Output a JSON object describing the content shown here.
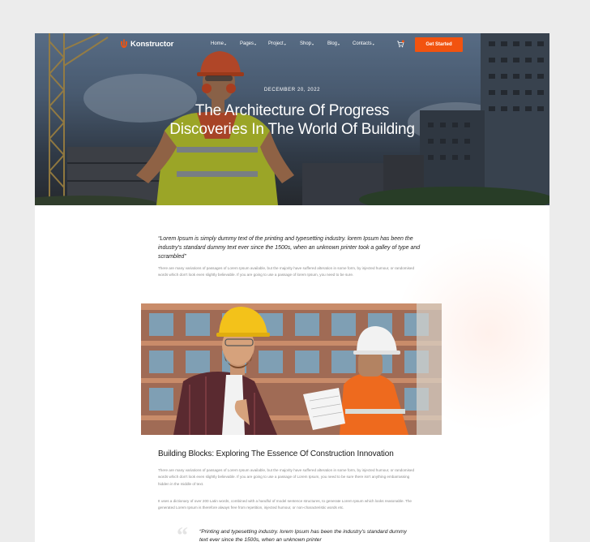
{
  "brand": {
    "name": "Konstructor",
    "accent": "#f2530f"
  },
  "nav": {
    "items": [
      {
        "label": "Home"
      },
      {
        "label": "Pages"
      },
      {
        "label": "Project"
      },
      {
        "label": "Shop"
      },
      {
        "label": "Blog"
      },
      {
        "label": "Contacts"
      }
    ],
    "cta_label": "Get Started",
    "cart_icon": "cart-icon"
  },
  "hero": {
    "date": "DECEMBER 20, 2022",
    "title": "The Architecture Of Progress Discoveries In The World Of Building"
  },
  "article": {
    "lead_quote": "“Lorem Ipsum is simply dummy text of the printing and typesetting industry. lorem Ipsum has been the industry's standard dummy text ever since the 1500s, when an unknown printer took a galley of type and scrambled”",
    "intro": "There are many variations of passages of Lorem Ipsum available, but the majority have suffered alteration in some form, by injected humour, or randomised words which don't look even slightly believable. If you are going to use a passage of lorem Ipsum, you need to be sure.",
    "section_title": "Building Blocks: Exploring The Essence Of Construction Innovation",
    "section_para_1": "There are many variations of passages of Lorem Ipsum available, but the majority have suffered alteration in some form, by injected humour, or randomised words which don't look even slightly believable. If you are going to use a passage of Lorem Ipsum, you need to be sure there isn't anything embarrassing hidden in the middle of text.",
    "section_para_2": "It uses a dictionary of over 200 Latin words, combined with a handful of model sentence structures, to generate Lorem Ipsum which looks reasonable. The generated Lorem Ipsum is therefore always free from repetition, injected humour, or non-characteristic words etc.",
    "pull_quote": "“Printing and typesetting industry. lorem Ipsum has been the industry's standard dummy text ever since the 1500s, when an unknown printer"
  }
}
